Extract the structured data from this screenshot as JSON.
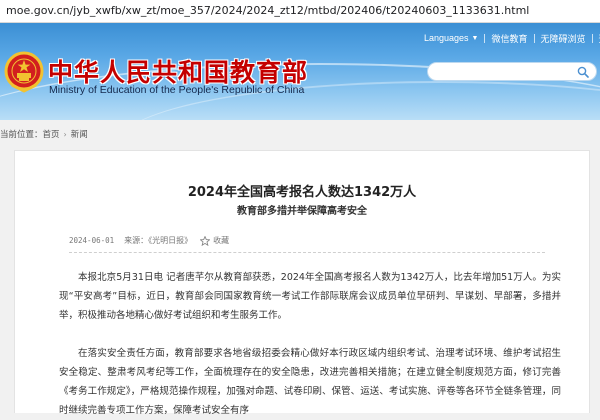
{
  "browser": {
    "url": "moe.gov.cn/jyb_xwfb/xw_zt/moe_357/2024/2024_zt12/mtbd/202406/t20240603_1133631.html"
  },
  "header": {
    "site_name_cn": "中华人民共和国教育部",
    "site_name_en": "Ministry of Education of the People's Republic of China",
    "emblem_icon": "national-emblem-icon",
    "nav": {
      "languages": "Languages",
      "wechat": "微信教育",
      "accessibility": "无障碍浏览",
      "login": "登录",
      "account": "注册"
    },
    "search": {
      "placeholder": "",
      "icon": "search-icon"
    },
    "colors": {
      "sky_top": "#3b8fd4",
      "sky_bottom": "#b9def7",
      "title_red": "#c40000"
    }
  },
  "breadcrumb": {
    "label": "当前位置：",
    "home": "首页",
    "section": "新闻"
  },
  "article": {
    "title": "2024年全国高考报名人数达1342万人",
    "subtitle": "教育部多措并举保障高考安全",
    "date": "2024-06-01",
    "source": "来源：《光明日报》",
    "favorite_label": "收藏",
    "paragraphs": [
      "本报北京5月31日电 记者唐芊尔从教育部获悉，2024年全国高考报名人数为1342万人，比去年增加51万人。为实现“平安高考”目标，近日，教育部会同国家教育统一考试工作部际联席会议成员单位早研判、早谋划、早部署，多措并举，积极推动各地精心做好考试组织和考生服务工作。",
      "在落实安全责任方面，教育部要求各地省级招委会精心做好本行政区域内组织考试、治理考试环境、维护考试招生安全稳定、整肃考风考纪等工作，全面梳理存在的安全隐患，改进完善相关措施；在建立健全制度规范方面，修订完善《考务工作规定》，严格规范操作规程，加强对命题、试卷印刷、保管、运送、考试实施、评卷等各环节全链条管理，同时继续完善专项工作方案，保障考试安全有序"
    ]
  }
}
